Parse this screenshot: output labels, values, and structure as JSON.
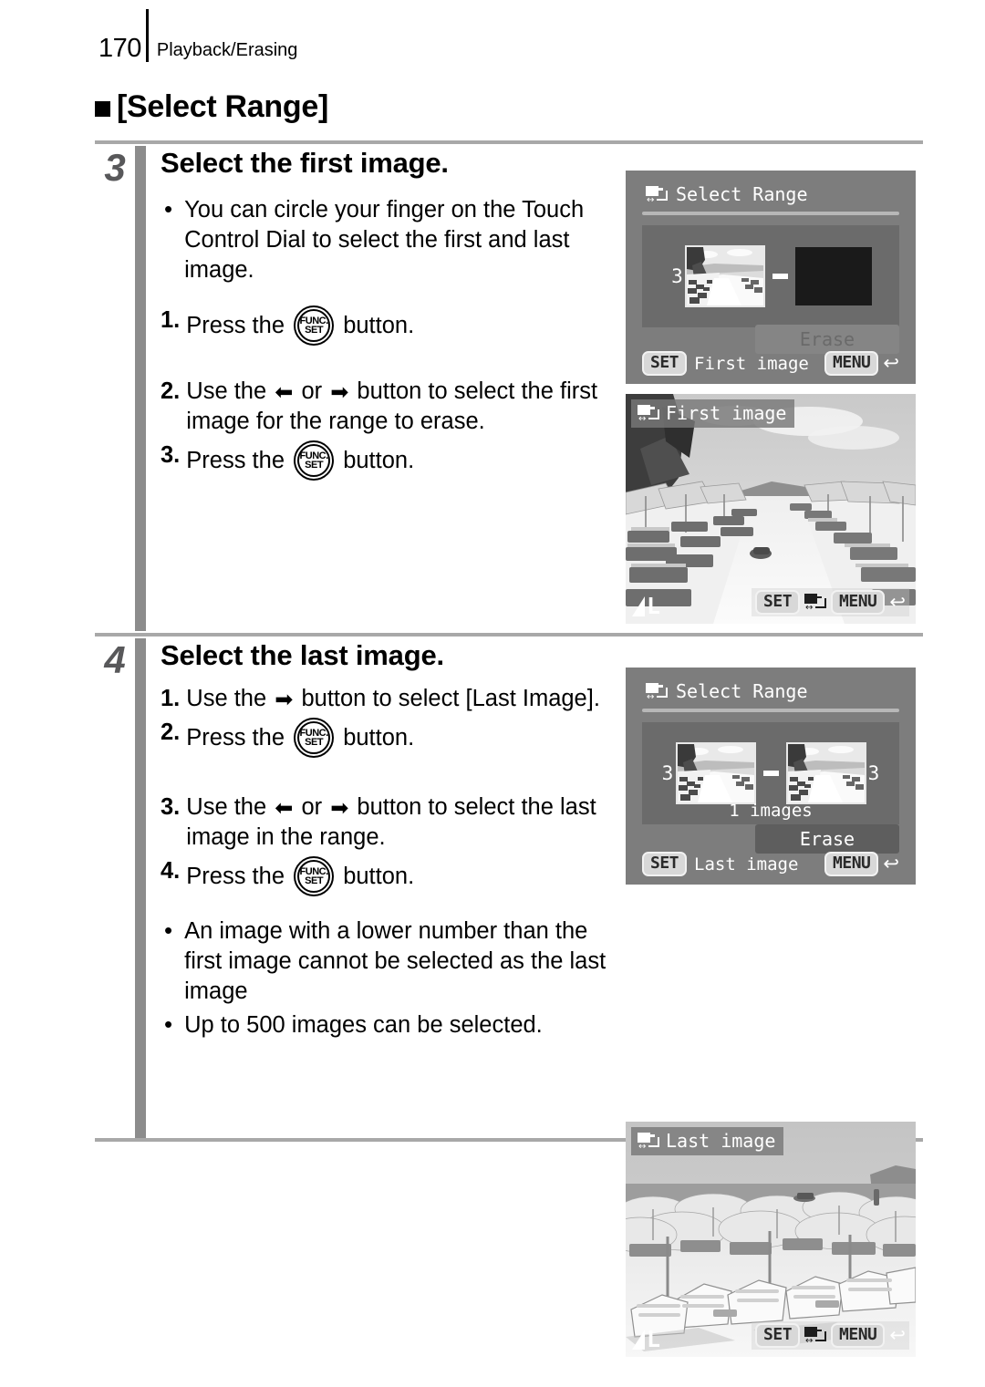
{
  "header": {
    "page_number": "170",
    "title": "Playback/Erasing"
  },
  "section": {
    "title": "[Select Range]"
  },
  "steps": [
    {
      "number": "3",
      "title": "Select the first image.",
      "items": [
        {
          "marker": "•",
          "text": "You can circle your finger on the Touch Control Dial to select the first and last image."
        },
        {
          "marker": "1.",
          "text_before": "Press the",
          "icon": "funcset-icon",
          "text_after": "button."
        },
        {
          "marker": "2.",
          "text_before": "Use the",
          "arrows": "left-right",
          "text_after": "button to select the first image for the range to erase."
        },
        {
          "marker": "3.",
          "text_before": "Press the",
          "icon": "funcset-icon",
          "text_after": "button."
        }
      ]
    },
    {
      "number": "4",
      "title": "Select the last image.",
      "items": [
        {
          "marker": "1.",
          "text_before": "Use the",
          "arrows": "right",
          "text_after": "button to select [Last Image]."
        },
        {
          "marker": "2.",
          "text_before": "Press the",
          "icon": "funcset-icon",
          "text_after": "button."
        },
        {
          "marker": "3.",
          "text_before": "Use the",
          "arrows": "left-right",
          "text_after": "button to select the last image in the range."
        },
        {
          "marker": "4.",
          "text_before": "Press the",
          "icon": "funcset-icon",
          "text_after": "button."
        },
        {
          "marker": "•",
          "text": "An image with a lower number than the first image cannot be selected as the last image"
        },
        {
          "marker": "•",
          "text": "Up to 500 images can be selected."
        }
      ]
    }
  ],
  "glyphs": {
    "arrow_left": "⬅",
    "arrow_right": "➡",
    "bullet": "•",
    "return_arrow": "↩",
    "double_arrow": "↔",
    "func_top": "FUNC.",
    "func_bottom": "SET"
  },
  "screens": {
    "select_range_first": {
      "title": "Select Range",
      "first_thumb_number": "3",
      "second_thumb_number": "",
      "separator": "-",
      "count_label": "",
      "erase_label": "Erase",
      "erase_state": "disabled",
      "footer_key": "SET",
      "footer_label": "First image",
      "menu_key": "MENU"
    },
    "photo_first": {
      "badge_label": "First image",
      "quality_label": "L",
      "set_key": "SET",
      "menu_key": "MENU"
    },
    "select_range_last": {
      "title": "Select Range",
      "first_thumb_number": "3",
      "second_thumb_number": "3",
      "separator": "-",
      "count_label": "1 images",
      "erase_label": "Erase",
      "erase_state": "enabled",
      "footer_key": "SET",
      "footer_label": "Last image",
      "menu_key": "MENU"
    },
    "photo_last": {
      "badge_label": "Last image",
      "quality_label": "L",
      "set_key": "SET",
      "menu_key": "MENU"
    }
  },
  "colors": {
    "screen_bg": "#7d7d7d",
    "tray_bg": "#6b6b6b",
    "rule": "#a8a8a8",
    "step_bar": "#8c8c8c",
    "step_number": "#58585a",
    "erase_disabled_text": "#6a6a6a"
  }
}
